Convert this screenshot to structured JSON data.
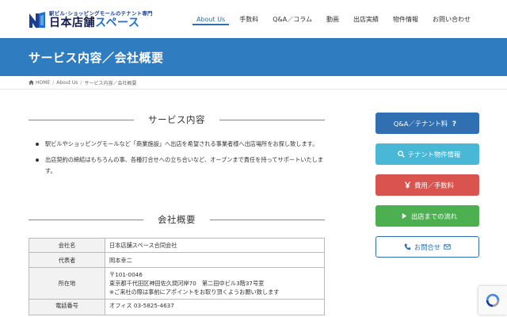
{
  "header": {
    "logo_sub": "駅ビル･ショッピングモールのテナント専門",
    "logo_main_a": "日本店舗",
    "logo_main_b": "スペース",
    "nav": [
      {
        "label": "About Us",
        "active": true
      },
      {
        "label": "手数料"
      },
      {
        "label": "Q&A／コラム"
      },
      {
        "label": "動画"
      },
      {
        "label": "出店実績"
      },
      {
        "label": "物件情報"
      },
      {
        "label": "お問い合わせ"
      }
    ]
  },
  "page_title": "サービス内容／会社概要",
  "breadcrumb": {
    "home": "HOME",
    "about": "About Us",
    "current": "サービス内容／会社概要"
  },
  "section1": {
    "heading": "サービス内容",
    "bullets": [
      "駅ビルやショッピングモールなど「商業施設」へ出店を希望される事業者様へ出店場所をお探し致します。",
      "出店契約の締結はもちろんの事、各種打合せへの立ち合いなど、オープンまで責任を持ってサポートいたします。"
    ]
  },
  "section2": {
    "heading": "会社概要",
    "rows": [
      {
        "label": "会社名",
        "value": "日本店舗スペース合同会社"
      },
      {
        "label": "代表者",
        "value": "岡本幸二"
      },
      {
        "label": "所在地",
        "line1": "〒101-0046",
        "line2": "東京都千代田区神田佐久間河岸70　第二田中ビル3階37号室",
        "line3": "※ご来社の際は事前にアポイントをお取り頂くようお願い致します"
      },
      {
        "label": "電話番号",
        "value": "オフィス 03-5825-4637"
      }
    ]
  },
  "sidebar": [
    {
      "label": "Q&A／テナント料",
      "icon": "question-icon"
    },
    {
      "label": "テナント物件情報",
      "icon": "search-icon"
    },
    {
      "label": "費用／手数料",
      "icon": "yen-icon"
    },
    {
      "label": "出店までの流れ",
      "icon": "arrow-right-icon"
    },
    {
      "label": "お問合せ",
      "icon": "phone-icon",
      "icon2": "mail-icon"
    }
  ],
  "colors": {
    "brand_blue": "#2f7dc0",
    "accent": "#2f6fab",
    "btn_cyan": "#48b8d6",
    "btn_red": "#d9534f",
    "btn_green": "#4caf50"
  }
}
